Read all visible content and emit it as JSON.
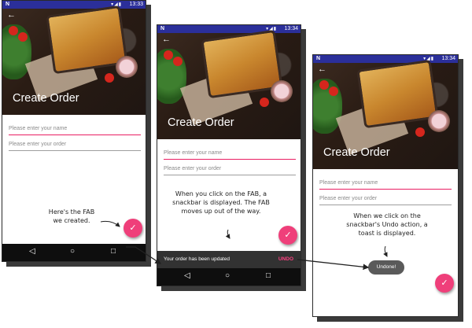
{
  "screens": [
    {
      "status": {
        "notif": "N",
        "icons": "▾◢▮",
        "time": "13:33"
      },
      "title": "Create Order",
      "name_placeholder": "Please enter your name",
      "order_placeholder": "Please enter your order",
      "fab_icon": "✓"
    },
    {
      "status": {
        "notif": "N",
        "icons": "▾◢▮",
        "time": "13:34"
      },
      "title": "Create Order",
      "name_placeholder": "Please enter your name",
      "order_placeholder": "Please enter your order",
      "fab_icon": "✓",
      "snackbar": {
        "message": "Your order has been updated",
        "action": "UNDO"
      }
    },
    {
      "status": {
        "notif": "N",
        "icons": "▾◢▮",
        "time": "13:34"
      },
      "title": "Create Order",
      "name_placeholder": "Please enter your name",
      "order_placeholder": "Please enter your order",
      "fab_icon": "✓",
      "toast": "Undone!"
    }
  ],
  "nav": {
    "back": "◁",
    "home": "○",
    "recent": "□"
  },
  "annotations": {
    "fab": "Here's the FAB we created.",
    "snackbar": "When you click on the FAB, a snackbar is displayed. The FAB moves up out of the way.",
    "toast": "When we click on the snackbar's Undo action, a toast is displayed."
  },
  "colors": {
    "status_bar": "#2b2f9a",
    "accent": "#e91e63",
    "fab": "#ef3f7a",
    "snackbar": "#323232",
    "undo": "#ff4081"
  }
}
